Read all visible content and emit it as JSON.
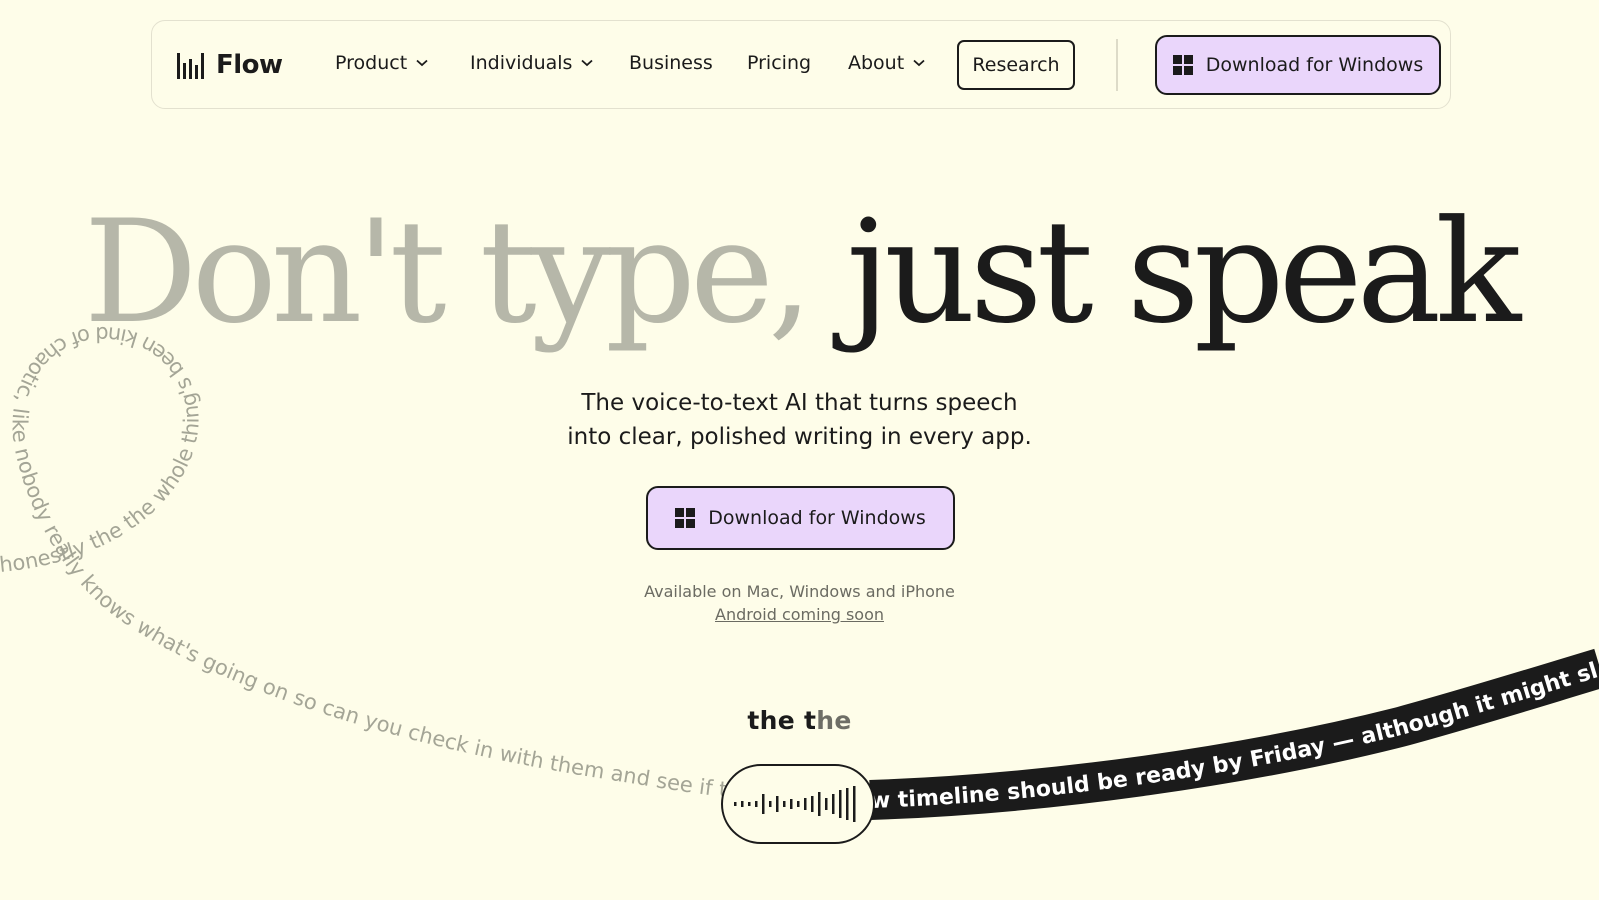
{
  "nav": {
    "logo_text": "Flow",
    "items": [
      {
        "label": "Product",
        "has_dropdown": true
      },
      {
        "label": "Individuals",
        "has_dropdown": true
      },
      {
        "label": "Business",
        "has_dropdown": false
      },
      {
        "label": "Pricing",
        "has_dropdown": false
      },
      {
        "label": "About",
        "has_dropdown": true
      }
    ],
    "research_label": "Research",
    "download_label": "Download for Windows"
  },
  "hero": {
    "headline_faded": "Don't type,",
    "headline_strong": "just speak",
    "subtitle_line1": "The voice-to-text AI that turns speech",
    "subtitle_line2": "into clear, polished writing in every app.",
    "download_label": "Download for Windows",
    "availability": "Available on Mac, Windows and iPhone",
    "android_link": "Android coming soon"
  },
  "demo": {
    "raw_speech": "honestly the the whole thing's been kind of chaotic, like nobody really knows what's going on so can you check in with them and see if the n",
    "live_word_done": "the t",
    "live_word_pending": "he",
    "polished_text": "w timeline should be ready by Friday — although it might slip. There's"
  },
  "colors": {
    "background": "#fefde9",
    "accent": "#ead6fb",
    "ink": "#1b1b1b",
    "faded_headline": "#b6b7a9"
  },
  "icons": {
    "logo": "waveform-bars-icon",
    "dropdown": "chevron-down-icon",
    "windows": "windows-logo-icon",
    "mic": "audio-waveform-icon"
  }
}
